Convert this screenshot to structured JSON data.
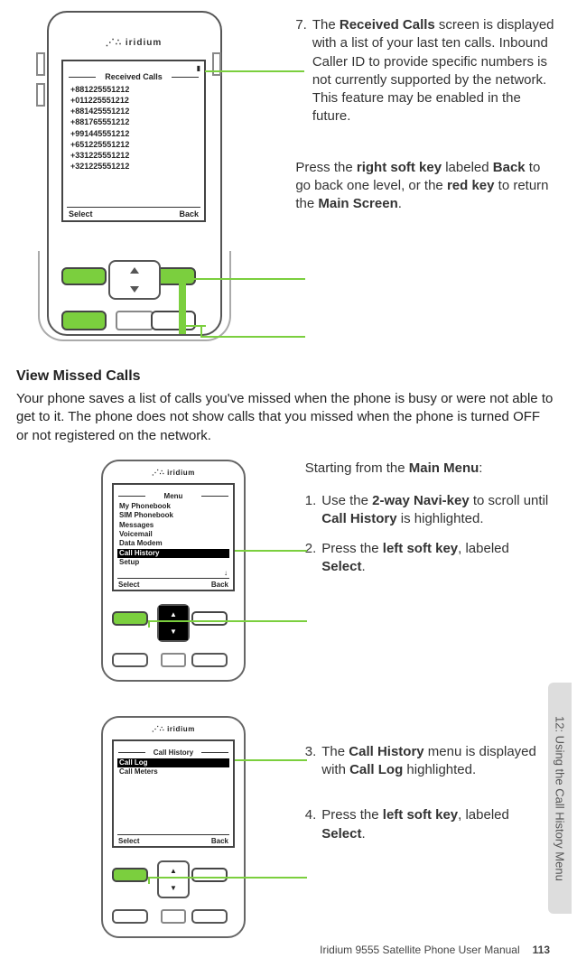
{
  "top_phone": {
    "brand": "⋰∴ iridium",
    "screen_title": "Received Calls",
    "call_list": [
      "+881225551212",
      "+011225551212",
      "+881425551212",
      "+881765551212",
      "+991445551212",
      "+651225551212",
      "+331225551212",
      "+321225551212"
    ],
    "softkey_left": "Select",
    "softkey_right": "Back"
  },
  "top_text_7": {
    "num": "7.",
    "body_a": "The ",
    "body_b": "Received Calls",
    "body_c": " screen is displayed with a list of your last ten calls. Inbound Caller ID to provide specific numbers is not currently supported by the network. This feature may be enabled in the future."
  },
  "top_text_back": {
    "a": "Press the ",
    "b": "right soft key",
    "c": " labeled ",
    "d": "Back",
    "e": " to go back one level, or the ",
    "f": "red key",
    "g": " to return the ",
    "h": "Main Screen",
    "i": "."
  },
  "section_heading": "View Missed Calls",
  "section_para": "Your phone saves a list of calls you've missed when the phone is busy or were not able to get to it. The phone does not show calls that you missed when the phone is turned OFF or not registered on the network.",
  "mid_intro_a": "Starting from the ",
  "mid_intro_b": "Main Menu",
  "mid_intro_c": ":",
  "mid_phone": {
    "brand": "⋰∴ iridium",
    "screen_title": "Menu",
    "menu": [
      "My Phonebook",
      "SIM Phonebook",
      "Messages",
      "Voicemail",
      "Data Modem",
      "Call History",
      "Setup"
    ],
    "highlight_index": 5,
    "softkey_left": "Select",
    "softkey_right": "Back",
    "scroll_arrow": "↓"
  },
  "step1": {
    "num": "1.",
    "a": "Use the ",
    "b": "2-way Navi-key",
    "c": " to scroll until ",
    "d": "Call History",
    "e": " is highlighted."
  },
  "step2": {
    "num": "2.",
    "a": "Press the ",
    "b": "left soft key",
    "c": ", labeled ",
    "d": "Select",
    "e": "."
  },
  "bot_phone": {
    "brand": "⋰∴ iridium",
    "screen_title": "Call History",
    "menu": [
      "Call Log",
      "Call Meters"
    ],
    "highlight_index": 0,
    "softkey_left": "Select",
    "softkey_right": "Back"
  },
  "step3": {
    "num": "3.",
    "a": "The ",
    "b": "Call History",
    "c": " menu is displayed with ",
    "d": "Call Log",
    "e": " highlighted."
  },
  "step4": {
    "num": "4.",
    "a": "Press the ",
    "b": "left soft key",
    "c": ", labeled ",
    "d": "Select",
    "e": "."
  },
  "side_tab": "12: Using the Call History Menu",
  "footer_text": "Iridium 9555 Satellite Phone User Manual",
  "footer_page": "113"
}
